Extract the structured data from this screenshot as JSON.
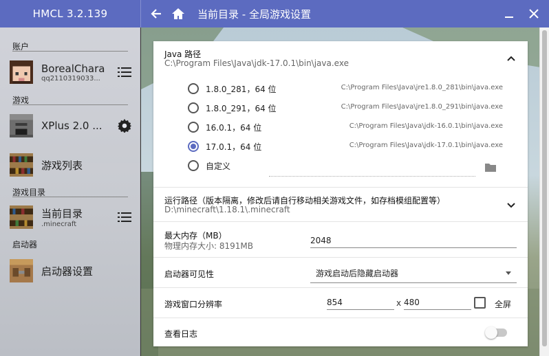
{
  "app": {
    "title": "HMCL 3.2.139"
  },
  "titlebar": {
    "page_title": "当前目录 - 全局游戏设置"
  },
  "sidebar": {
    "account_section": "账户",
    "account": {
      "name": "BorealChara",
      "id": "qq2110319033..."
    },
    "game_section": "游戏",
    "current_game": "XPlus 2.0 ...",
    "game_list": "游戏列表",
    "dir_section": "游戏目录",
    "current_dir": {
      "name": "当前目录",
      "path": ".minecraft"
    },
    "launcher_section": "启动器",
    "launcher_settings": "启动器设置"
  },
  "settings": {
    "java": {
      "title": "Java 路径",
      "value": "C:\\Program Files\\Java\\jdk-17.0.1\\bin\\java.exe",
      "options": [
        {
          "label": "1.8.0_281，64 位",
          "path": "C:\\Program Files\\Java\\jre1.8.0_281\\bin\\java.exe",
          "selected": false
        },
        {
          "label": "1.8.0_291，64 位",
          "path": "C:\\Program Files\\Java\\jre1.8.0_291\\bin\\java.exe",
          "selected": false
        },
        {
          "label": "16.0.1，64 位",
          "path": "C:\\Program Files\\Java\\jdk-16.0.1\\bin\\java.exe",
          "selected": false
        },
        {
          "label": "17.0.1，64 位",
          "path": "C:\\Program Files\\Java\\jdk-17.0.1\\bin\\java.exe",
          "selected": true
        }
      ],
      "custom_label": "自定义"
    },
    "run_dir": {
      "title": "运行路径（版本隔离，修改后请自行移动相关游戏文件，如存档模组配置等）",
      "value": "D:\\minecraft\\1.18.1\\.minecraft"
    },
    "memory": {
      "title": "最大内存（MB）",
      "sub": "物理内存大小: 8191MB",
      "value": "2048"
    },
    "visibility": {
      "title": "启动器可见性",
      "value": "游戏启动后隐藏启动器"
    },
    "resolution": {
      "title": "游戏窗口分辨率",
      "width": "854",
      "separator": "x",
      "height": "480",
      "fullscreen_label": "全屏",
      "fullscreen": false
    },
    "log": {
      "title": "查看日志",
      "enabled": false
    }
  },
  "colors": {
    "accent": "#5c6bc0",
    "titlebar": "#5c6bc0"
  }
}
